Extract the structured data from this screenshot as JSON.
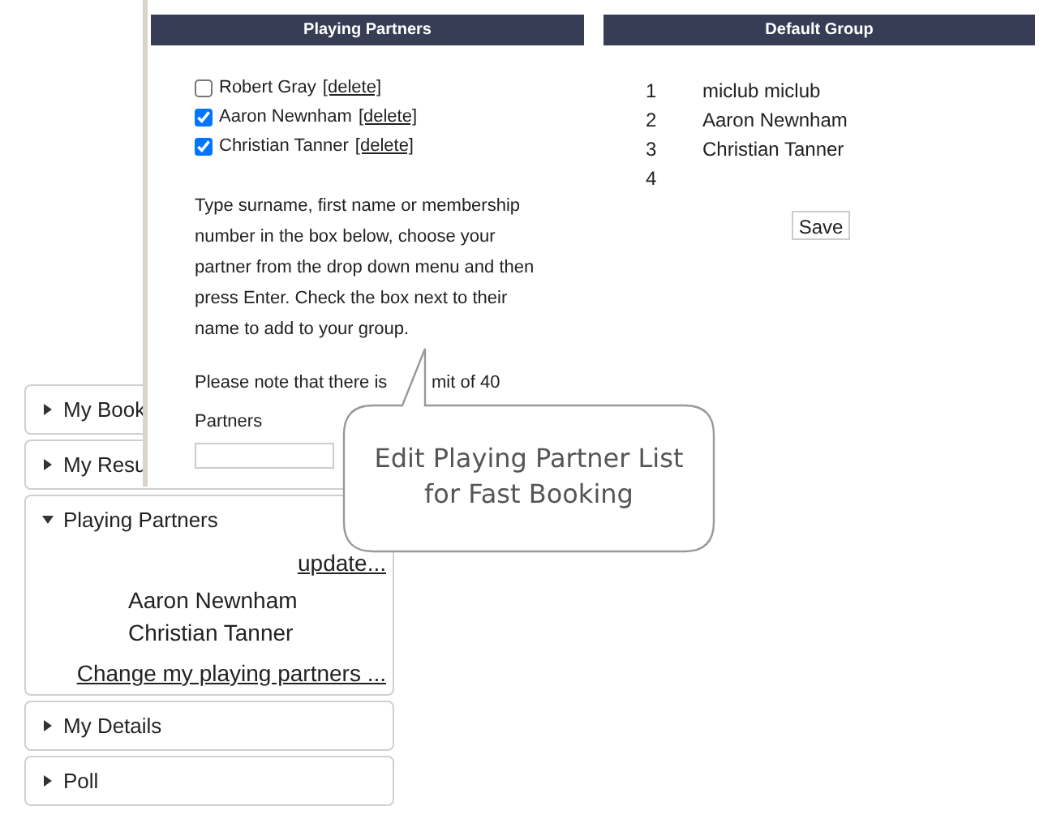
{
  "sidebar": {
    "items": [
      {
        "label": "My Book",
        "expanded": false
      },
      {
        "label": "My Resu",
        "expanded": false
      },
      {
        "label": "Playing Partners",
        "expanded": true,
        "action": "update...",
        "partners": [
          "Aaron Newnham",
          "Christian Tanner"
        ],
        "link": "Change my playing partners ..."
      },
      {
        "label": "My Details",
        "expanded": false
      },
      {
        "label": "Poll",
        "expanded": false
      }
    ]
  },
  "partners_panel": {
    "title": "Playing Partners",
    "partners": [
      {
        "name": "Robert Gray",
        "checked": false,
        "delete": "[delete]"
      },
      {
        "name": "Aaron Newnham",
        "checked": true,
        "delete": "[delete]"
      },
      {
        "name": "Christian Tanner",
        "checked": true,
        "delete": "[delete]"
      }
    ],
    "instructions": "Type surname, first name or membership number in the box below, choose your partner from the drop down menu and then press Enter. Check the box next to their name to add to your group.",
    "note_before": "Please note that there is",
    "note_after": "mit of 40",
    "note_end": "Partners"
  },
  "default_group": {
    "title": "Default Group",
    "rows": [
      {
        "number": "1",
        "name": "miclub miclub"
      },
      {
        "number": "2",
        "name": "Aaron Newnham"
      },
      {
        "number": "3",
        "name": "Christian Tanner"
      },
      {
        "number": "4"
      }
    ],
    "save": "Save"
  },
  "callout": {
    "lines": [
      "Edit Playing Partner List",
      "for Fast Booking"
    ]
  }
}
